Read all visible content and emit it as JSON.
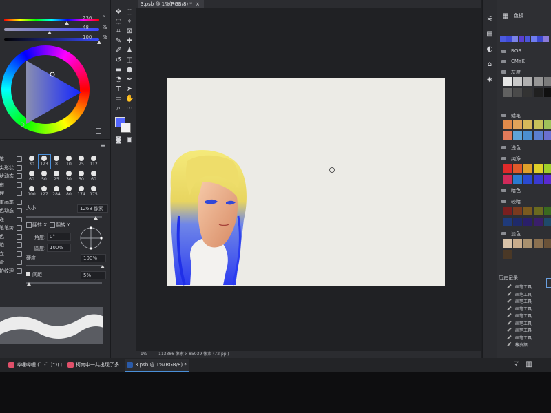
{
  "sliders": [
    {
      "value": "236",
      "unit": "°",
      "gradient": "linear-gradient(90deg,#ff0000,#ffff00,#00ff00,#00ffff,#0000ff,#ff00ff,#ff0000)",
      "knob": 0.66
    },
    {
      "value": "48",
      "unit": "%",
      "gradient": "linear-gradient(90deg,#9a9ab5,#3c46ff)",
      "knob": 0.48
    },
    {
      "value": "100",
      "unit": "%",
      "gradient": "linear-gradient(90deg,#000000,#3a4cff)",
      "knob": 1.0
    }
  ],
  "brush": {
    "sizes_row1": [
      "30",
      "123",
      "8",
      "10",
      "25",
      "112"
    ],
    "sizes_row2": [
      "60",
      "50",
      "25",
      "30",
      "50",
      "60"
    ],
    "sizes_row3": [
      "100",
      "127",
      "284",
      "80",
      "174",
      "175"
    ],
    "left_labels": [
      "画笔",
      "笔尖形状",
      "形状动态",
      "散布",
      "纹理",
      "双重画笔",
      "颜色动态",
      "传递",
      "画笔笔势",
      "杂色",
      "湿边",
      "建立",
      "平滑",
      "保护纹理"
    ],
    "size_label": "大小",
    "size_value": "1268 像素",
    "flip_x": "翻转 X",
    "flip_y": "翻转 Y",
    "angle_label": "角度:",
    "angle_value": "0°",
    "roundness_label": "圆度:",
    "roundness_value": "100%",
    "hardness_label": "硬度",
    "hardness_value": "100%",
    "spacing_label": "间距",
    "spacing_value": "5%"
  },
  "document": {
    "tab_title": "3.psb @ 1%(RGB/8) *",
    "zoom": "1%",
    "status": "113386 像素 x 85039 像素 (72 ppi)"
  },
  "right_panel": {
    "title": "色板",
    "groups": [
      "RGB",
      "CMYK",
      "灰度",
      "蜡笔",
      "浅色",
      "纯净",
      "暗色",
      "较暗",
      "淡色"
    ],
    "recent_swatches": [
      "#4b5ae0",
      "#3f4bd8",
      "#7a83e8",
      "#5a3fd0",
      "#4a55d9",
      "#6f7cf0",
      "#3c48cf",
      "#8a7ad9"
    ],
    "gray_swatches": [
      "#e6e6e6",
      "#c9c9c9",
      "#b0b0b0",
      "#969696",
      "#7b7b7b",
      "#616161",
      "#4a4a4a",
      "#333333",
      "#202020",
      "#101010"
    ],
    "pastel_swatches": [
      "#e08a4a",
      "#e0a35a",
      "#d6b85a",
      "#c8c25a",
      "#9fc25a",
      "#e07a5a",
      "#5fa3d8",
      "#4b8fd0",
      "#5a7fd0",
      "#6a6fd0"
    ],
    "pure_swatches": [
      "#e02a2a",
      "#e05a2a",
      "#e0a02a",
      "#e0d02a",
      "#a0d02a",
      "#d02a5a",
      "#2a7ad0",
      "#2a4ad0",
      "#3a3ad0",
      "#5a2ad0"
    ],
    "dark_swatches": [
      "#7a1f1f",
      "#7a3a1f",
      "#7a5a1f",
      "#6a6a1f",
      "#3a6a1f",
      "#1f3a7a",
      "#1f2a6a",
      "#2a1f6a",
      "#3a1f6a",
      "#1f4a6a"
    ],
    "tint_swatches": [
      "#d8c2a8",
      "#c8ac8c",
      "#a8906e",
      "#8a7050",
      "#6a5238",
      "#4a3826"
    ],
    "history_title": "历史记录",
    "history_items": [
      "画笔工具",
      "画笔工具",
      "画笔工具",
      "画笔工具",
      "画笔工具",
      "画笔工具",
      "画笔工具",
      "画笔工具",
      "橡皮擦"
    ]
  },
  "taskbar": {
    "items": [
      {
        "label": "哔哩哔哩 (゜-゜)つロ ...",
        "color": "#e0506a"
      },
      {
        "label": "柯南中一共出现了多...",
        "color": "#e0506a"
      },
      {
        "label": "3.psb @ 1%(RGB/8) *",
        "color": "#2a5aa8"
      }
    ]
  }
}
